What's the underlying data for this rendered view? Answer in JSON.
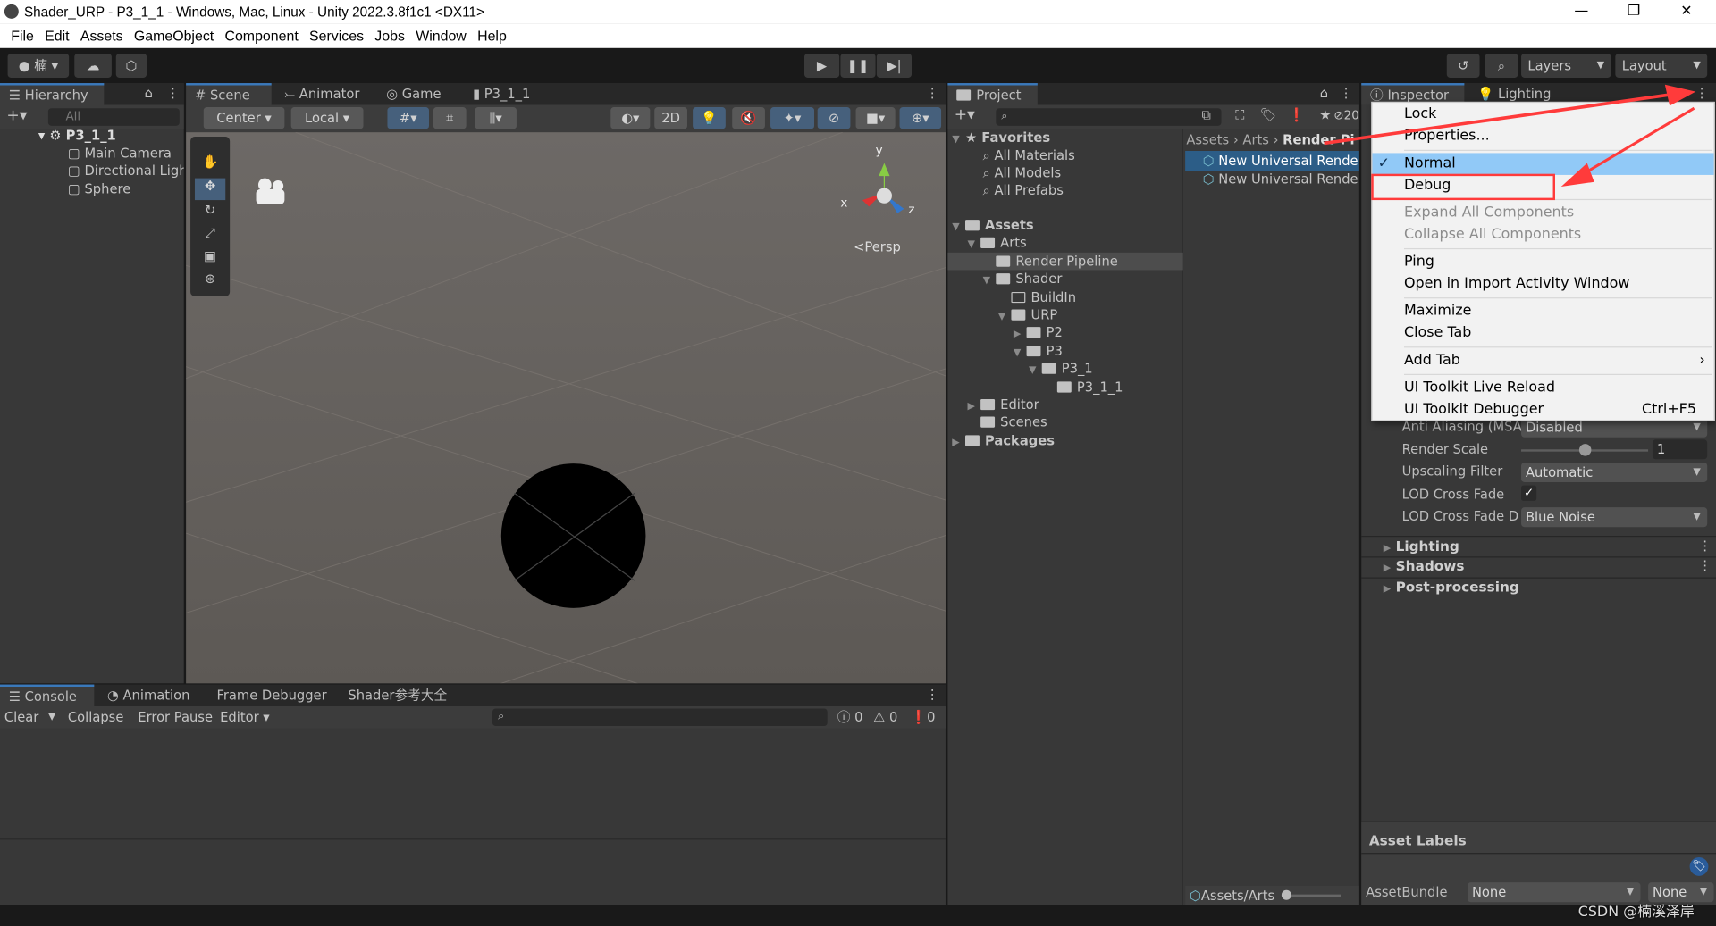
{
  "window": {
    "title": "Shader_URP - P3_1_1 - Windows, Mac, Linux - Unity 2022.3.8f1c1 <DX11>",
    "minimize": "—",
    "maximize": "❐",
    "close": "✕"
  },
  "menubar": [
    "File",
    "Edit",
    "Assets",
    "GameObject",
    "Component",
    "Services",
    "Jobs",
    "Window",
    "Help"
  ],
  "toolbar": {
    "account": "楠",
    "layers": "Layers",
    "layout": "Layout"
  },
  "hierarchy": {
    "tab": "Hierarchy",
    "search_placeholder": "All",
    "scene": "P3_1_1",
    "items": [
      "Main Camera",
      "Directional Light",
      "Sphere"
    ]
  },
  "scene_tabs": [
    "Scene",
    "Animator",
    "Game",
    "P3_1_1"
  ],
  "scene_toolbar": {
    "pivot": "Center",
    "space": "Local",
    "mode2d": "2D"
  },
  "scene_view": {
    "persp": "<Persp",
    "axis_y": "y",
    "axis_x": "x",
    "axis_z": "z"
  },
  "project": {
    "tab": "Project",
    "hidden_count": "20",
    "favorites": {
      "label": "Favorites",
      "items": [
        "All Materials",
        "All Models",
        "All Prefabs"
      ]
    },
    "tree": [
      {
        "label": "Assets",
        "depth": 0,
        "bold": true,
        "open": true
      },
      {
        "label": "Arts",
        "depth": 1,
        "open": true
      },
      {
        "label": "Render Pipeline",
        "depth": 2,
        "selected": true
      },
      {
        "label": "Shader",
        "depth": 2,
        "open": true
      },
      {
        "label": "BuildIn",
        "depth": 3,
        "empty": true
      },
      {
        "label": "URP",
        "depth": 3,
        "open": true
      },
      {
        "label": "P2",
        "depth": 4,
        "closed": true
      },
      {
        "label": "P3",
        "depth": 4,
        "open": true
      },
      {
        "label": "P3_1",
        "depth": 5,
        "open": true
      },
      {
        "label": "P3_1_1",
        "depth": 6
      },
      {
        "label": "Editor",
        "depth": 1,
        "closed": true
      },
      {
        "label": "Scenes",
        "depth": 1
      },
      {
        "label": "Packages",
        "depth": 0,
        "bold": true,
        "closed": true
      }
    ],
    "breadcrumb": [
      "Assets",
      "Arts",
      "Render Pi"
    ],
    "files": [
      "New Universal Rende",
      "New Universal Rende"
    ],
    "footer_path": "Assets/Arts"
  },
  "inspector": {
    "tabs": [
      "Inspector",
      "Lighting"
    ],
    "fields": [
      {
        "label": "Anti Aliasing (MSA",
        "value": "Disabled"
      },
      {
        "label": "Render Scale",
        "value": "1",
        "slider": 0.5
      },
      {
        "label": "Upscaling Filter",
        "value": "Automatic"
      },
      {
        "label": "LOD Cross Fade",
        "checked": true
      },
      {
        "label": "LOD Cross Fade D",
        "value": "Blue Noise"
      }
    ],
    "sections": [
      "Lighting",
      "Shadows",
      "Post-processing"
    ],
    "asset_labels": "Asset Labels",
    "asset_bundle": {
      "label": "AssetBundle",
      "value": "None",
      "variant": "None"
    }
  },
  "context_menu": {
    "items": [
      {
        "label": "Lock"
      },
      {
        "label": "Properties..."
      },
      {
        "sep": true
      },
      {
        "label": "Normal",
        "checked": true,
        "highlighted": true
      },
      {
        "label": "Debug",
        "annotated": true
      },
      {
        "sep": true
      },
      {
        "label": "Expand All Components",
        "disabled": true
      },
      {
        "label": "Collapse All Components",
        "disabled": true
      },
      {
        "sep": true
      },
      {
        "label": "Ping"
      },
      {
        "label": "Open in Import Activity Window"
      },
      {
        "sep": true
      },
      {
        "label": "Maximize"
      },
      {
        "label": "Close Tab"
      },
      {
        "sep": true
      },
      {
        "label": "Add Tab",
        "submenu": true
      },
      {
        "sep": true
      },
      {
        "label": "UI Toolkit Live Reload"
      },
      {
        "label": "UI Toolkit Debugger",
        "shortcut": "Ctrl+F5"
      }
    ]
  },
  "console": {
    "tabs": [
      "Console",
      "Animation",
      "Frame Debugger",
      "Shader参考大全"
    ],
    "buttons": [
      "Clear",
      "Collapse",
      "Error Pause",
      "Editor"
    ],
    "counts": {
      "info": "0",
      "warn": "0",
      "error": "0"
    }
  },
  "watermark": "CSDN @楠溪泽岸",
  "colors": {
    "accent": "#3a79bb",
    "selection": "#2c5d87",
    "menu_highlight": "#91c9f7",
    "annotation": "#ff3b3b"
  }
}
